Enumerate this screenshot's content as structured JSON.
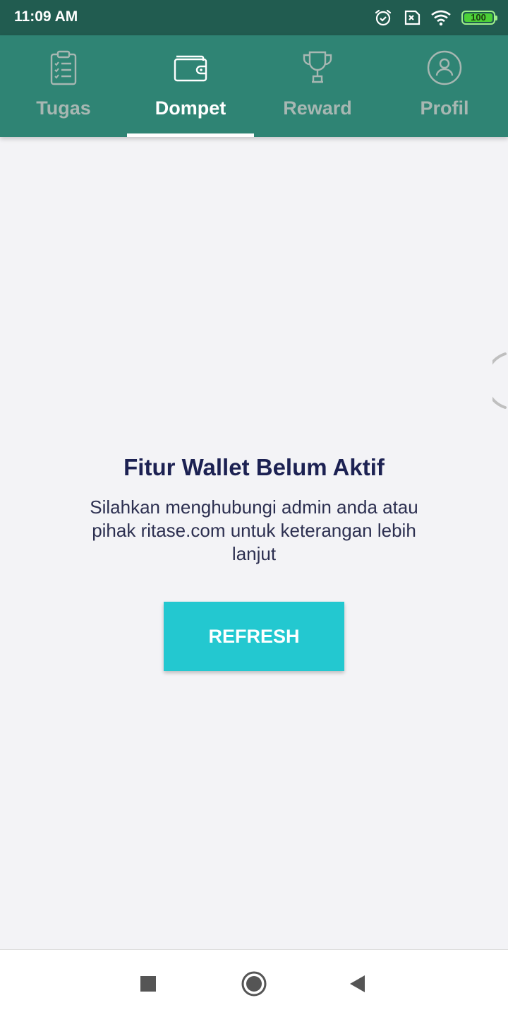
{
  "status_bar": {
    "time": "11:09 AM",
    "battery_level": "100",
    "icons": [
      "alarm-icon",
      "sim-off-icon",
      "wifi-icon",
      "battery-icon"
    ]
  },
  "tabs": [
    {
      "label": "Tugas",
      "icon": "clipboard-checklist-icon",
      "active": false
    },
    {
      "label": "Dompet",
      "icon": "wallet-icon",
      "active": true
    },
    {
      "label": "Reward",
      "icon": "trophy-icon",
      "active": false
    },
    {
      "label": "Profil",
      "icon": "person-circle-icon",
      "active": false
    }
  ],
  "empty_state": {
    "title": "Fitur Wallet Belum Aktif",
    "message": "Silahkan menghubungi admin anda atau pihak ritase.com untuk keterangan lebih lanjut",
    "button_label": "REFRESH"
  },
  "colors": {
    "status_bar": "#215c50",
    "tab_bar": "#2f8474",
    "tab_inactive": "#a7b7b2",
    "tab_active": "#ffffff",
    "title_text": "#1c2152",
    "button": "#23c8d0",
    "background": "#f3f3f6"
  },
  "nav_bar": {
    "buttons": [
      "recents-icon",
      "home-icon",
      "back-icon"
    ]
  }
}
